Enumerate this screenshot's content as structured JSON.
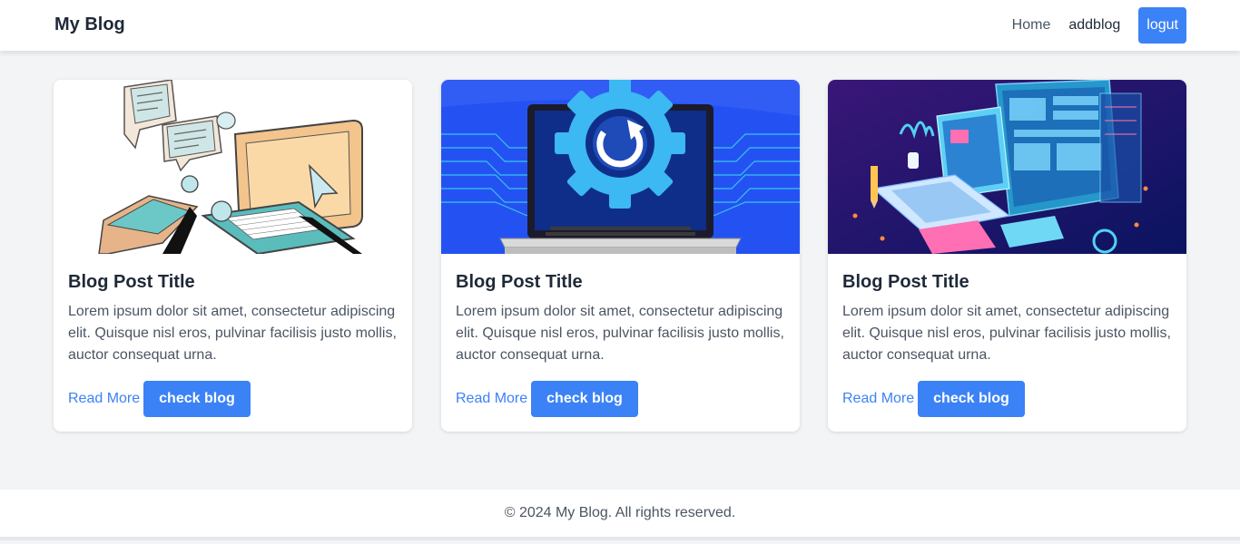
{
  "header": {
    "brand": "My Blog",
    "nav": {
      "home": "Home",
      "addblog": "addblog",
      "logout": "logut"
    }
  },
  "colors": {
    "accent": "#3b82f6",
    "background": "#f3f4f6"
  },
  "posts": [
    {
      "image_icon": "isometric-laptop-chat-illustration",
      "title": "Blog Post Title",
      "excerpt": "Lorem ipsum dolor sit amet, consectetur adipiscing elit. Quisque nisl eros, pulvinar facilisis justo mollis, auctor consequat urna.",
      "read_more": "Read More",
      "check_label": "check blog"
    },
    {
      "image_icon": "laptop-update-gear-illustration",
      "title": "Blog Post Title",
      "excerpt": "Lorem ipsum dolor sit amet, consectetur adipiscing elit. Quisque nisl eros, pulvinar facilisis justo mollis, auctor consequat urna.",
      "read_more": "Read More",
      "check_label": "check blog"
    },
    {
      "image_icon": "isometric-devices-dashboard-illustration",
      "title": "Blog Post Title",
      "excerpt": "Lorem ipsum dolor sit amet, consectetur adipiscing elit. Quisque nisl eros, pulvinar facilisis justo mollis, auctor consequat urna.",
      "read_more": "Read More",
      "check_label": "check blog"
    }
  ],
  "footer": {
    "text": "© 2024 My Blog. All rights reserved."
  }
}
